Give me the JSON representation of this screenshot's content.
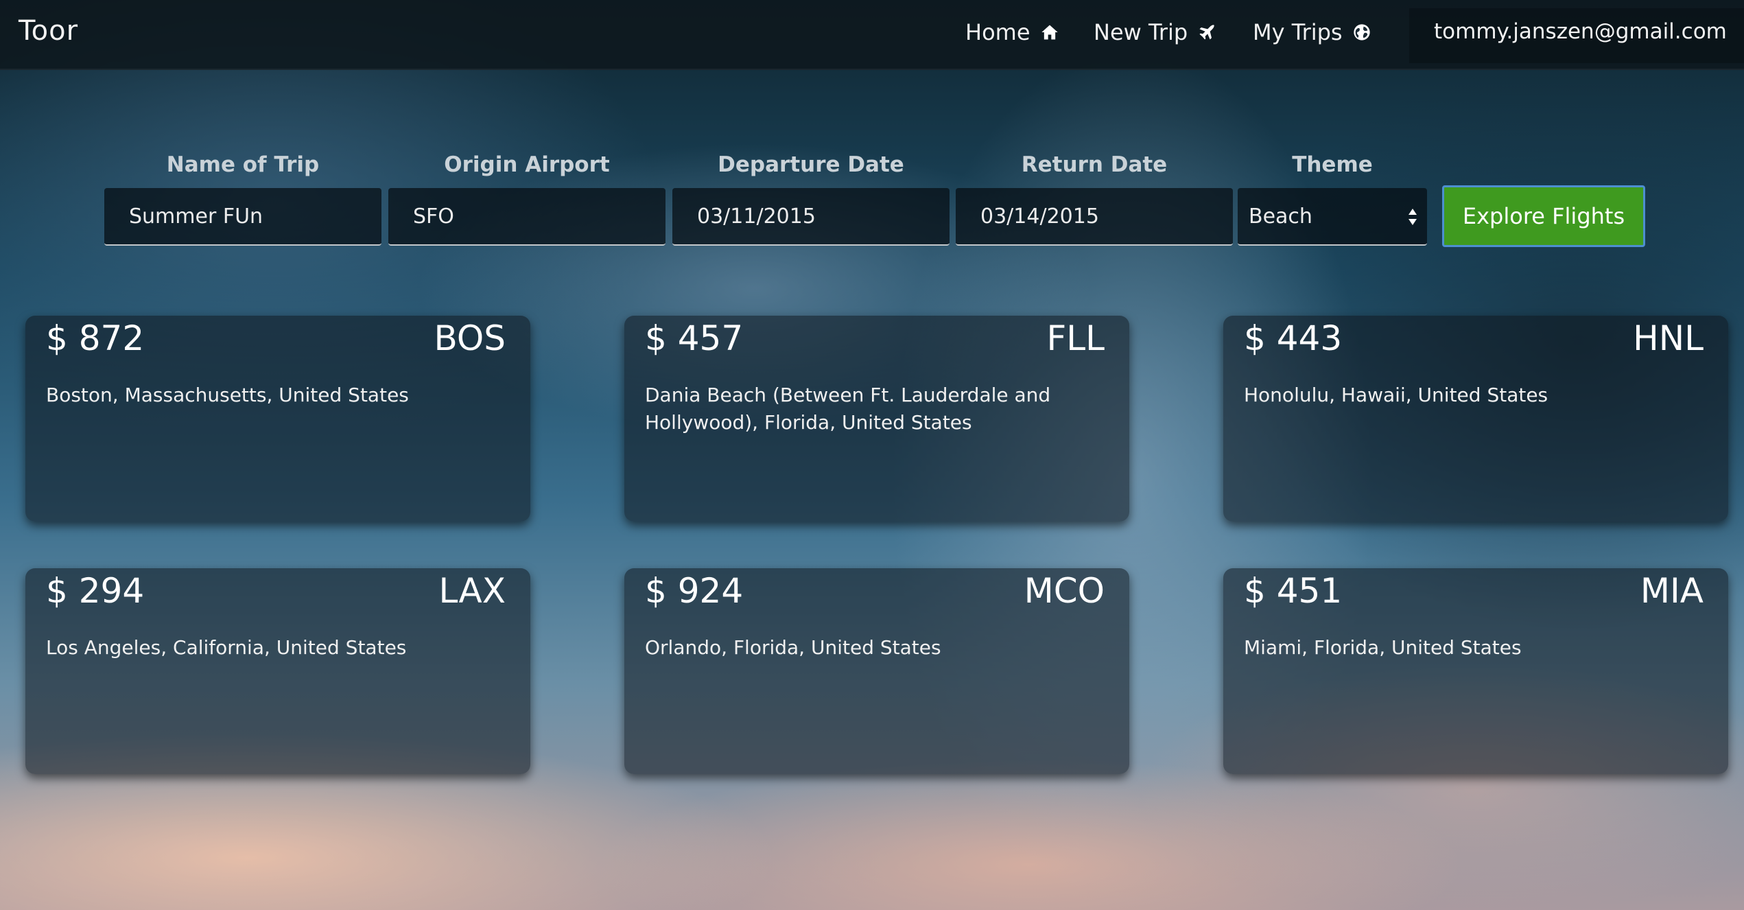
{
  "app": {
    "brand": "Toor"
  },
  "nav": {
    "items": [
      {
        "label": "Home",
        "icon": "home-icon"
      },
      {
        "label": "New Trip",
        "icon": "plane-icon"
      },
      {
        "label": "My Trips",
        "icon": "globe-icon"
      }
    ],
    "user_email": "tommy.janszen@gmail.com"
  },
  "form": {
    "trip_name": {
      "label": "Name of Trip",
      "value": "Summer FUn"
    },
    "origin": {
      "label": "Origin Airport",
      "value": "SFO"
    },
    "departure": {
      "label": "Departure Date",
      "value": "03/11/2015"
    },
    "return": {
      "label": "Return Date",
      "value": "03/14/2015"
    },
    "theme": {
      "label": "Theme",
      "value": "Beach"
    },
    "submit_label": "Explore Flights"
  },
  "results": [
    {
      "price": "$ 872",
      "code": "BOS",
      "city": "Boston, Massachusetts, United States"
    },
    {
      "price": "$ 457",
      "code": "FLL",
      "city": "Dania Beach (Between Ft. Lauderdale and Hollywood), Florida, United States"
    },
    {
      "price": "$ 443",
      "code": "HNL",
      "city": "Honolulu, Hawaii, United States"
    },
    {
      "price": "$ 294",
      "code": "LAX",
      "city": "Los Angeles, California, United States"
    },
    {
      "price": "$ 924",
      "code": "MCO",
      "city": "Orlando, Florida, United States"
    },
    {
      "price": "$ 451",
      "code": "MIA",
      "city": "Miami, Florida, United States"
    }
  ],
  "colors": {
    "accent_button": "#3f9a1f",
    "button_border": "#4d8fd0"
  }
}
